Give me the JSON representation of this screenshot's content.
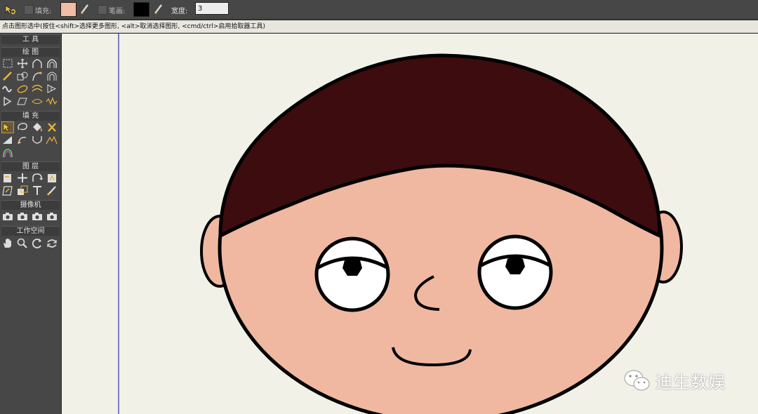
{
  "toolbar": {
    "fill_label": "填充:",
    "stroke_label": "笔画:",
    "width_label": "宽度:",
    "width_value": "3",
    "fill_color": "#f2bca6",
    "stroke_color": "#000000"
  },
  "hint": "点击图形选中(按住<shift>选择更多图形, <alt>取消选择图形, <cmd/ctrl>启用拾取器工具)",
  "panel": {
    "tools_title": "工 具",
    "sections": [
      "绘 图",
      "填 充",
      "图 层",
      "摄像机",
      "工作空间"
    ]
  },
  "watermark": "迪生数娱",
  "colors": {
    "hair": "#3d0c0e",
    "skin": "#f0b8a0",
    "eye_white": "#ffffff",
    "outline": "#000000",
    "canvas": "#f2f1e8",
    "guide": "#7c7cc8"
  }
}
